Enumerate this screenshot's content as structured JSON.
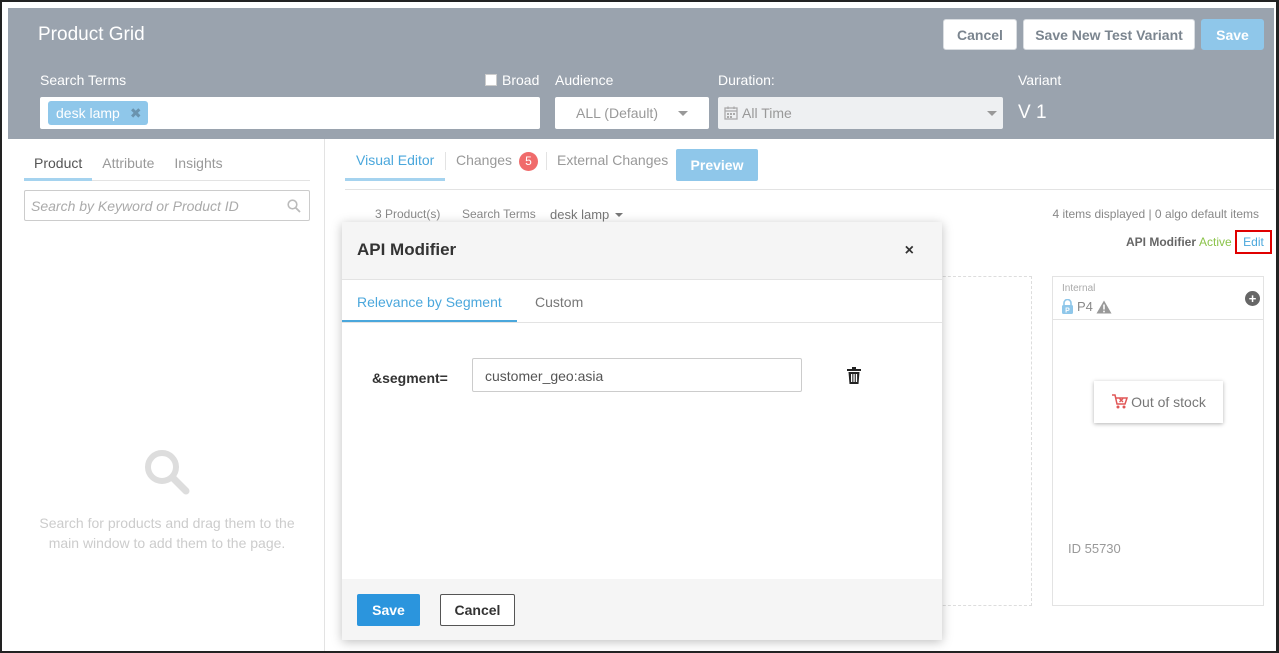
{
  "header": {
    "title": "Product Grid",
    "cancel_label": "Cancel",
    "save_variant_label": "Save New Test Variant",
    "save_label": "Save",
    "search_terms_label": "Search Terms",
    "search_tag": "desk lamp",
    "broad_label": "Broad",
    "audience_label": "Audience",
    "audience_value": "ALL (Default)",
    "duration_label": "Duration:",
    "duration_value": "All Time",
    "variant_label": "Variant",
    "variant_value": "V 1"
  },
  "left_panel": {
    "tabs": [
      {
        "label": "Product",
        "active": true
      },
      {
        "label": "Attribute",
        "active": false
      },
      {
        "label": "Insights",
        "active": false
      }
    ],
    "search_placeholder": "Search by Keyword or Product ID",
    "empty_text": "Search for products and drag them to the main window to add them to the page."
  },
  "main": {
    "tabs": {
      "visual_editor": "Visual Editor",
      "changes": "Changes",
      "changes_count": "5",
      "external_changes": "External Changes",
      "preview": "Preview"
    },
    "product_count": "3 Product(s)",
    "search_terms_label": "Search Terms",
    "search_terms_value": "desk lamp",
    "items_displayed": "4 items displayed | 0 algo default items",
    "api_modifier_label": "API Modifier",
    "api_modifier_status": "Active",
    "edit_label": "Edit",
    "card": {
      "internal_label": "Internal",
      "position": "P4",
      "out_of_stock": "Out of stock",
      "id_text": "ID 55730"
    }
  },
  "modal": {
    "title": "API Modifier",
    "close_symbol": "×",
    "tabs": [
      {
        "label": "Relevance by Segment",
        "active": true
      },
      {
        "label": "Custom",
        "active": false
      }
    ],
    "segment_label": "&segment=",
    "segment_value": "customer_geo:asia",
    "save_label": "Save",
    "cancel_label": "Cancel"
  },
  "colors": {
    "header_bg": "#9aa3ae",
    "accent_blue": "#4aa7dc",
    "light_blue": "#8fc7ea",
    "save_blue": "#2b95dd",
    "badge_red": "#f06b6b",
    "active_green": "#8bc34a",
    "edit_highlight": "#e00000"
  },
  "icons": [
    "close-x-icon",
    "chevron-down-icon",
    "calendar-icon",
    "search-icon",
    "lock-icon",
    "warning-icon",
    "plus-circle-icon",
    "cart-icon",
    "trash-icon"
  ]
}
